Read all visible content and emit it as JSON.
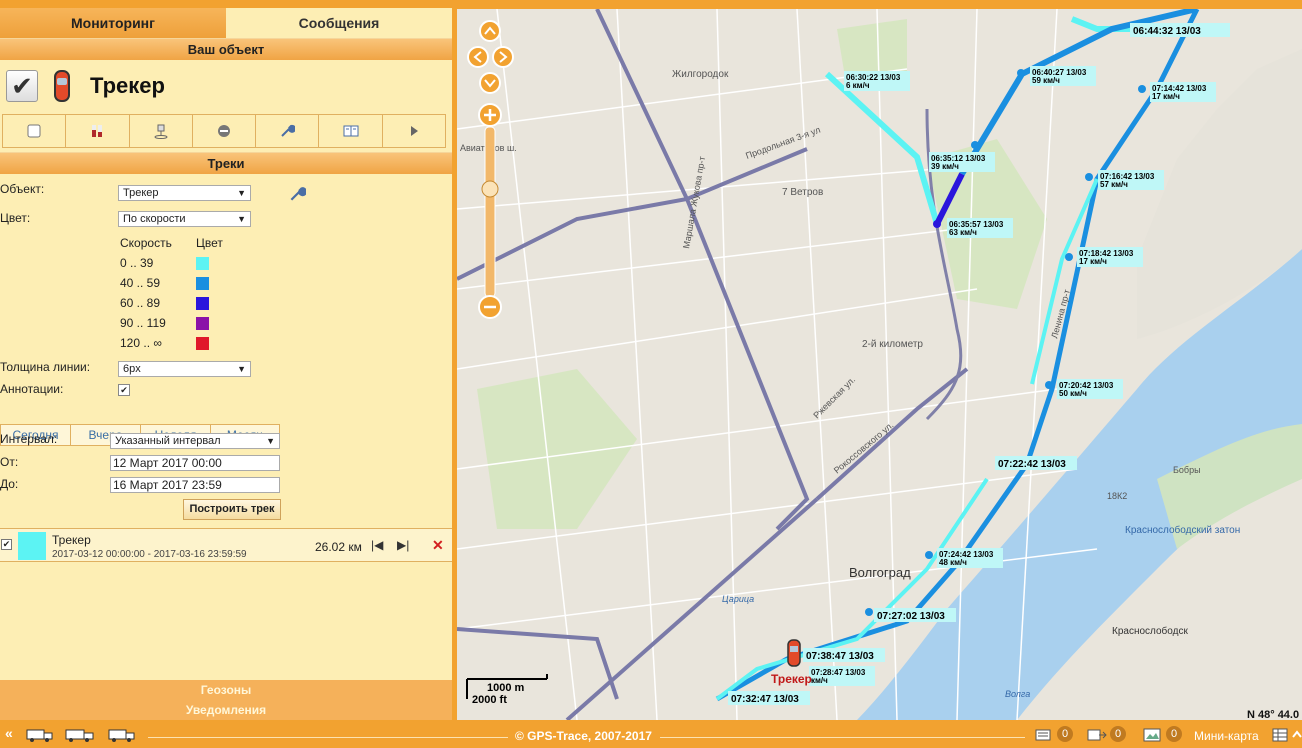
{
  "tabs": {
    "monitoring": "Мониторинг",
    "messages": "Сообщения"
  },
  "object_section": {
    "title": "Ваш объект",
    "name": "Трекер"
  },
  "tracks_section": {
    "title": "Треки",
    "object_label": "Объект:",
    "object_value": "Трекер",
    "color_label": "Цвет:",
    "color_value": "По скорости",
    "speed_header": "Скорость",
    "color_header": "Цвет",
    "speed_ranges": [
      {
        "label": "0 .. 39",
        "color": "#5cf3f3"
      },
      {
        "label": "40 .. 59",
        "color": "#1a8fe0"
      },
      {
        "label": "60 .. 89",
        "color": "#2a16dc"
      },
      {
        "label": "90 .. 119",
        "color": "#8a12a8"
      },
      {
        "label": "120 .. ∞",
        "color": "#e0182a"
      }
    ],
    "line_width_label": "Толщина линии:",
    "line_width_value": "6px",
    "annotations_label": "Аннотации:",
    "periods": [
      "Сегодня",
      "Вчера",
      "Неделя",
      "Месяц"
    ],
    "interval_label": "Интервал:",
    "interval_value": "Указанный интервал",
    "from_label": "От:",
    "from_value": "12 Март 2017 00:00",
    "to_label": "До:",
    "to_value": "16 Март 2017 23:59",
    "build_button": "Построить трек"
  },
  "track": {
    "name": "Трекер",
    "range": "2017-03-12 00:00:00 - 2017-03-16 23:59:59",
    "distance": "26.02 км",
    "color": "#5cf3f3"
  },
  "bottom_links": {
    "geozones": "Геозоны",
    "notifications": "Уведомления"
  },
  "map": {
    "places": [
      "Жилгородок",
      "Авиаторов ш.",
      "Продольная 3-я ул.",
      "7 Ветров",
      "2-й километр",
      "Волгоград",
      "Бобры",
      "Краснослободский затон",
      "Краснослободск",
      "Волга",
      "Царица",
      "Маршала Жукова пр-т",
      "Рокоссовского ул.",
      "Ленина пр-т",
      "Прoдольная 3-я ул",
      "Ржевская ул.",
      "18К2"
    ],
    "annotations": [
      {
        "time": "06:44:32 13/03",
        "speed": ""
      },
      {
        "time": "06:30:22 13/03",
        "speed": "6 км/ч"
      },
      {
        "time": "06:40:27 13/03",
        "speed": "59 км/ч"
      },
      {
        "time": "07:14:42 13/03",
        "speed": "17 км/ч"
      },
      {
        "time": "06:35:12 13/03",
        "speed": "39 км/ч"
      },
      {
        "time": "07:16:42 13/03",
        "speed": "57 км/ч"
      },
      {
        "time": "06:35:57 13/03",
        "speed": "63 км/ч"
      },
      {
        "time": "07:18:42 13/03",
        "speed": "17 км/ч"
      },
      {
        "time": "07:20:42 13/03",
        "speed": "50 км/ч"
      },
      {
        "time": "07:22:42 13/03",
        "speed": ""
      },
      {
        "time": "07:24:42 13/03",
        "speed": "48 км/ч"
      },
      {
        "time": "07:27:02 13/03",
        "speed": ""
      },
      {
        "time": "07:38:47 13/03",
        "speed": ""
      },
      {
        "time": "07:28:47 13/03",
        "speed": "км/ч"
      },
      {
        "time": "07:32:47 13/03",
        "speed": ""
      }
    ],
    "marker_label": "Трекер",
    "scale_metric": "1000 m",
    "scale_imperial": "2000 ft",
    "coords": "N 48° 44.0"
  },
  "footer": {
    "copyright": "© GPS-Trace, 2007-2017",
    "count_messages": "0",
    "count_commands": "0",
    "count_images": "0",
    "minimap": "Мини-карта"
  }
}
